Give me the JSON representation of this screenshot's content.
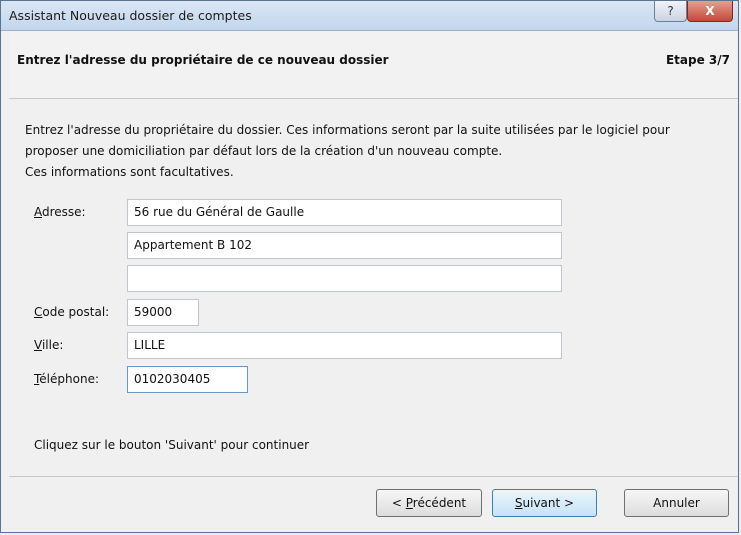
{
  "window": {
    "title": "Assistant Nouveau dossier de comptes",
    "help_glyph": "?",
    "close_glyph": "X"
  },
  "header": {
    "title": "Entrez l'adresse du propriétaire de ce nouveau dossier",
    "step": "Etape 3/7"
  },
  "intro": {
    "line1": "Entrez l'adresse du propriétaire du dossier. Ces informations seront par la suite utilisées par le logiciel pour",
    "line2": "proposer une domiciliation par défaut lors de la création d'un nouveau compte.",
    "line3": "Ces informations sont facultatives."
  },
  "form": {
    "address_label_key": "A",
    "address_label_rest": "dresse:",
    "address_line1": "56 rue du Général de Gaulle",
    "address_line2": "Appartement B 102",
    "address_line3": "",
    "postal_label_key": "C",
    "postal_label_rest": "ode postal:",
    "postal_code": "59000",
    "city_label_key": "V",
    "city_label_rest": "ille:",
    "city": "LILLE",
    "phone_label_key": "T",
    "phone_label_rest": "éléphone:",
    "phone": "0102030405"
  },
  "footer": {
    "hint": "Cliquez sur le bouton 'Suivant' pour continuer"
  },
  "buttons": {
    "prev_prefix": "< ",
    "prev_key": "P",
    "prev_rest": "récédent",
    "next_key": "S",
    "next_rest": "uivant >",
    "cancel": "Annuler"
  }
}
